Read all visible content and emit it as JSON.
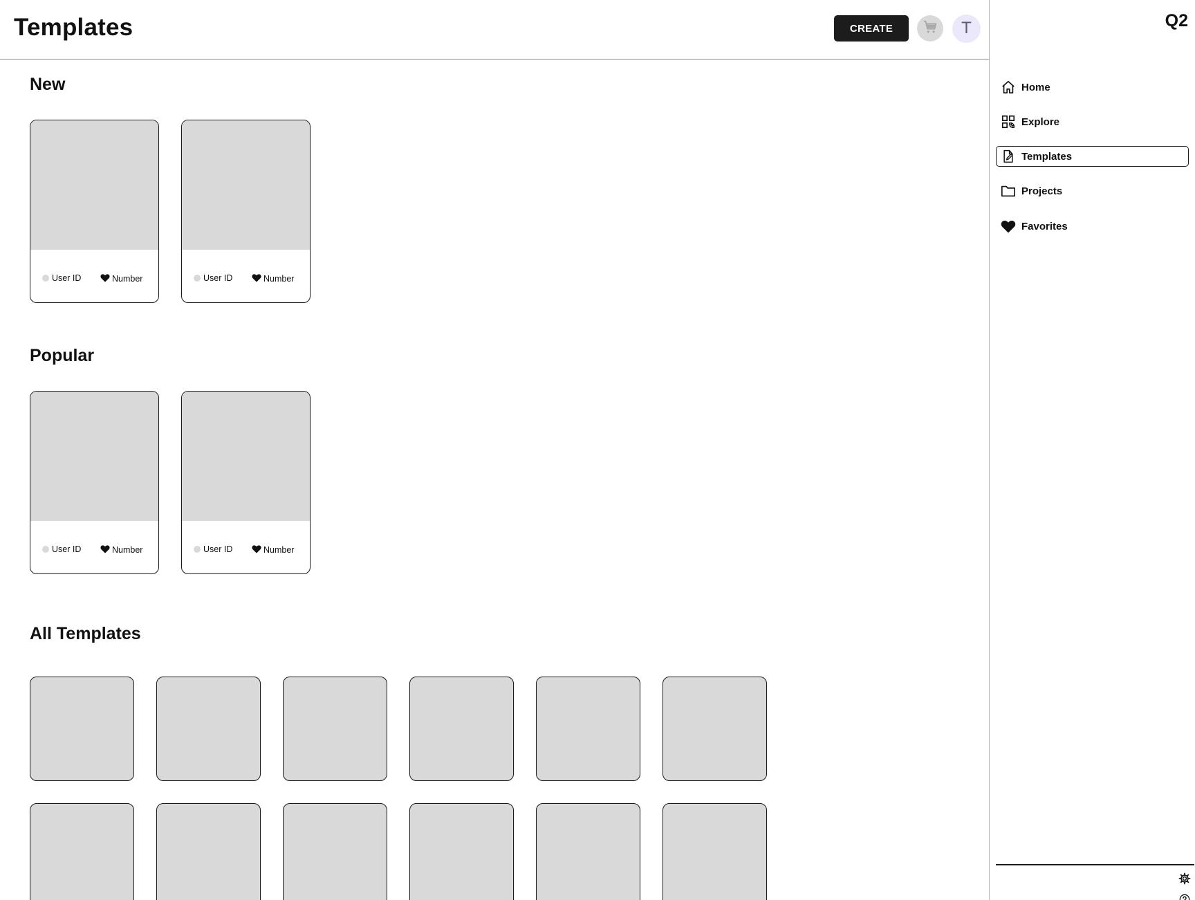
{
  "header": {
    "title": "Templates",
    "create_label": "CREATE",
    "avatar_initial": "T"
  },
  "sections": {
    "new": {
      "title": "New",
      "cards": [
        {
          "user": "User ID",
          "likes": "Number"
        },
        {
          "user": "User ID",
          "likes": "Number"
        }
      ]
    },
    "popular": {
      "title": "Popular",
      "cards": [
        {
          "user": "User ID",
          "likes": "Number"
        },
        {
          "user": "User ID",
          "likes": "Number"
        }
      ]
    },
    "all": {
      "title": "All Templates"
    }
  },
  "sidebar": {
    "brand": "Q2",
    "items": [
      {
        "label": "Home",
        "icon": "home-icon"
      },
      {
        "label": "Explore",
        "icon": "explore-icon"
      },
      {
        "label": "Templates",
        "icon": "template-icon",
        "active": true
      },
      {
        "label": "Projects",
        "icon": "folder-icon"
      },
      {
        "label": "Favorites",
        "icon": "heart-icon"
      }
    ],
    "footer_icons": [
      "gear-icon",
      "help-icon"
    ]
  },
  "colors": {
    "placeholder": "#d9d9d9",
    "button_dark": "#1c1c1c",
    "avatar_bg": "#ebe8fb"
  }
}
